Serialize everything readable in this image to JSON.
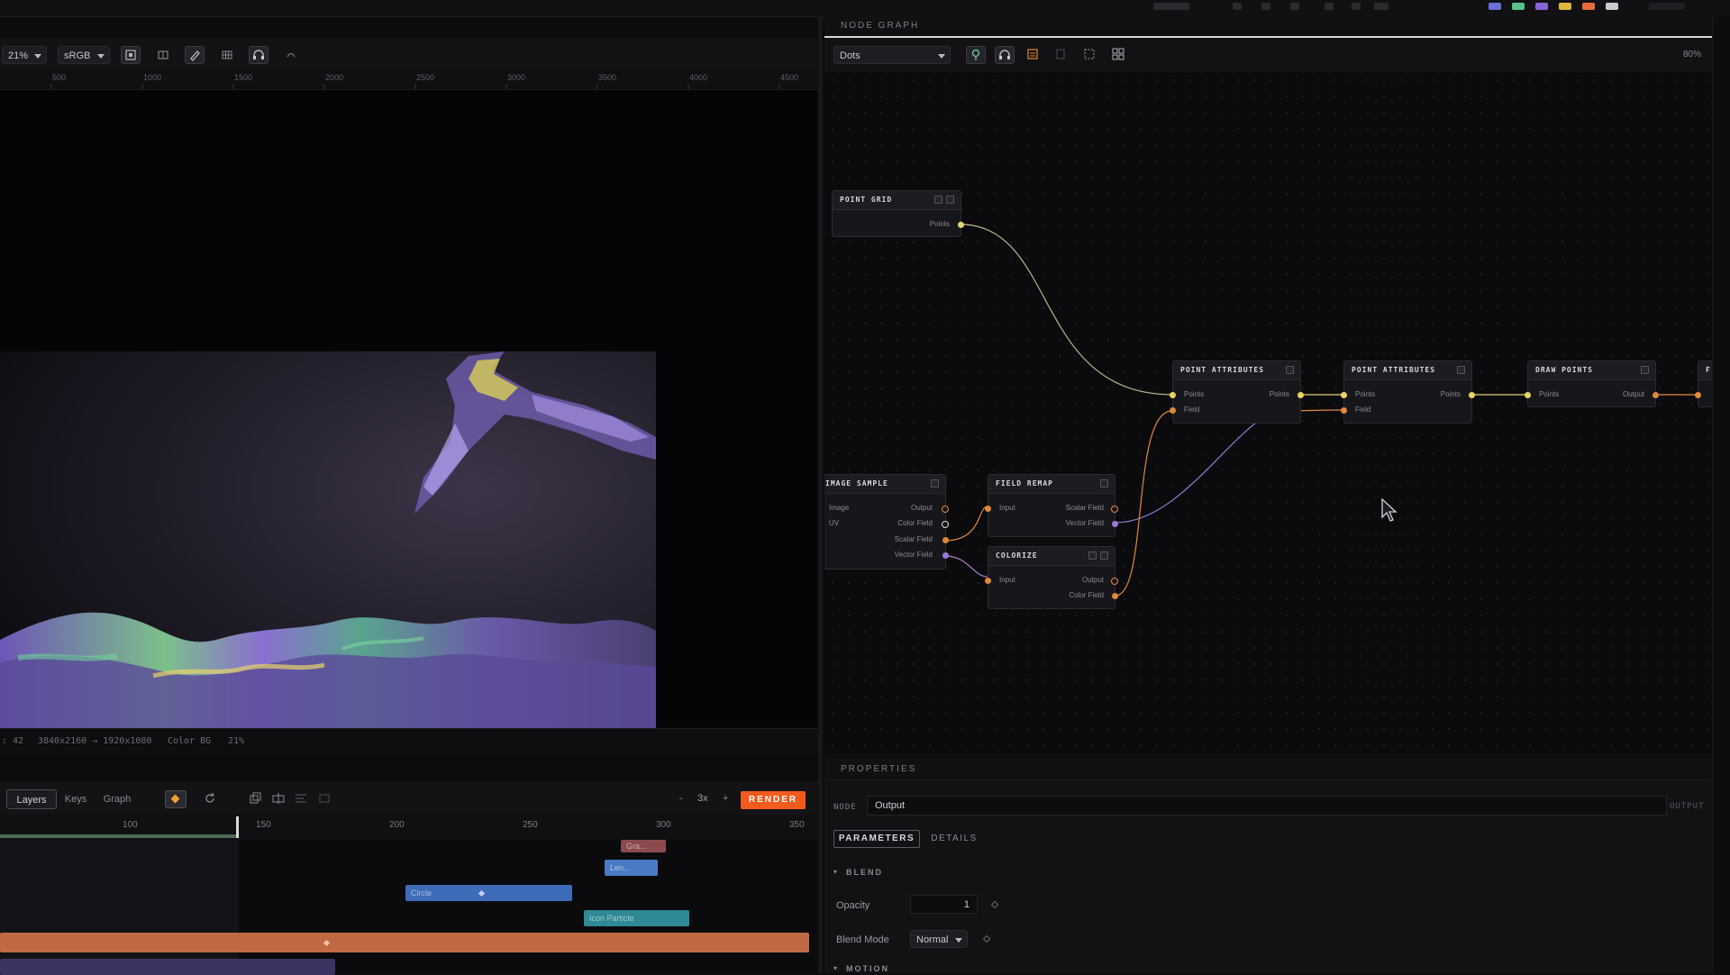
{
  "viewer": {
    "zoom": "21%",
    "colorspace": "sRGB",
    "ruler_ticks": [
      "500",
      "1000",
      "1500",
      "2000",
      "2500",
      "3000",
      "3500",
      "4000",
      "4500"
    ],
    "status": {
      "frame": ": 42",
      "resolution": "3840x2160 → 1920x1080",
      "background": "Color BG",
      "zoom": "21%"
    }
  },
  "timeline": {
    "tabs": [
      "Layers",
      "Keys",
      "Graph"
    ],
    "active_tab": "Layers",
    "speed_minus": "-",
    "speed": "3x",
    "speed_plus": "+",
    "render_label": "RENDER",
    "ruler_numbers": [
      "100",
      "150",
      "200",
      "250",
      "300",
      "350"
    ],
    "playhead_frame": 143,
    "clips": [
      {
        "label": "Gra...",
        "color": "#8a4a4f"
      },
      {
        "label": "Len...",
        "color": "#4b7ac4"
      },
      {
        "label": "Circle",
        "color": "#3f6cb8"
      },
      {
        "label": "Icon Particle",
        "color": "#2f8a95"
      },
      {
        "label": "",
        "color": "#c06a44"
      },
      {
        "label": "",
        "color": "#3a3560"
      }
    ]
  },
  "node_graph": {
    "title": "NODE GRAPH",
    "preset": "Dots",
    "zoom": "80%",
    "nodes": {
      "point_grid": {
        "title": "POINT GRID",
        "outputs": [
          "Points"
        ]
      },
      "point_attributes_1": {
        "title": "POINT ATTRIBUTES",
        "inputs": [
          "Points",
          "Field"
        ],
        "outputs": [
          "Points"
        ]
      },
      "point_attributes_2": {
        "title": "POINT ATTRIBUTES",
        "inputs": [
          "Points",
          "Field"
        ],
        "outputs": [
          "Points"
        ]
      },
      "draw_points": {
        "title": "DRAW POINTS",
        "inputs": [
          "Points"
        ],
        "outputs": [
          "Output"
        ]
      },
      "image_sample": {
        "title": "IMAGE SAMPLE",
        "inputs": [
          "Image",
          "UV"
        ],
        "outputs": [
          "Output",
          "Color Field",
          "Scalar Field",
          "Vector Field"
        ]
      },
      "field_remap": {
        "title": "FIELD REMAP",
        "inputs": [
          "Input"
        ],
        "outputs": [
          "Scalar Field",
          "Vector Field"
        ]
      },
      "colorize": {
        "title": "COLORIZE",
        "inputs": [
          "Input"
        ],
        "outputs": [
          "Output",
          "Color Field"
        ]
      },
      "partial_node": {
        "title": "F"
      }
    }
  },
  "properties": {
    "title": "PROPERTIES",
    "node_label": "NODE",
    "node_value": "Output",
    "node_type": "OUTPUT",
    "tabs": [
      "PARAMETERS",
      "DETAILS"
    ],
    "blend_section": "BLEND",
    "opacity_label": "Opacity",
    "opacity_value": "1",
    "blend_mode_label": "Blend Mode",
    "blend_mode_value": "Normal",
    "motion_section": "MOTION"
  },
  "colors": {
    "accent": "#f25a1e",
    "wire_yellow": "#e8d36a",
    "wire_orange": "#e0893b",
    "wire_purple": "#9b7bd6"
  }
}
